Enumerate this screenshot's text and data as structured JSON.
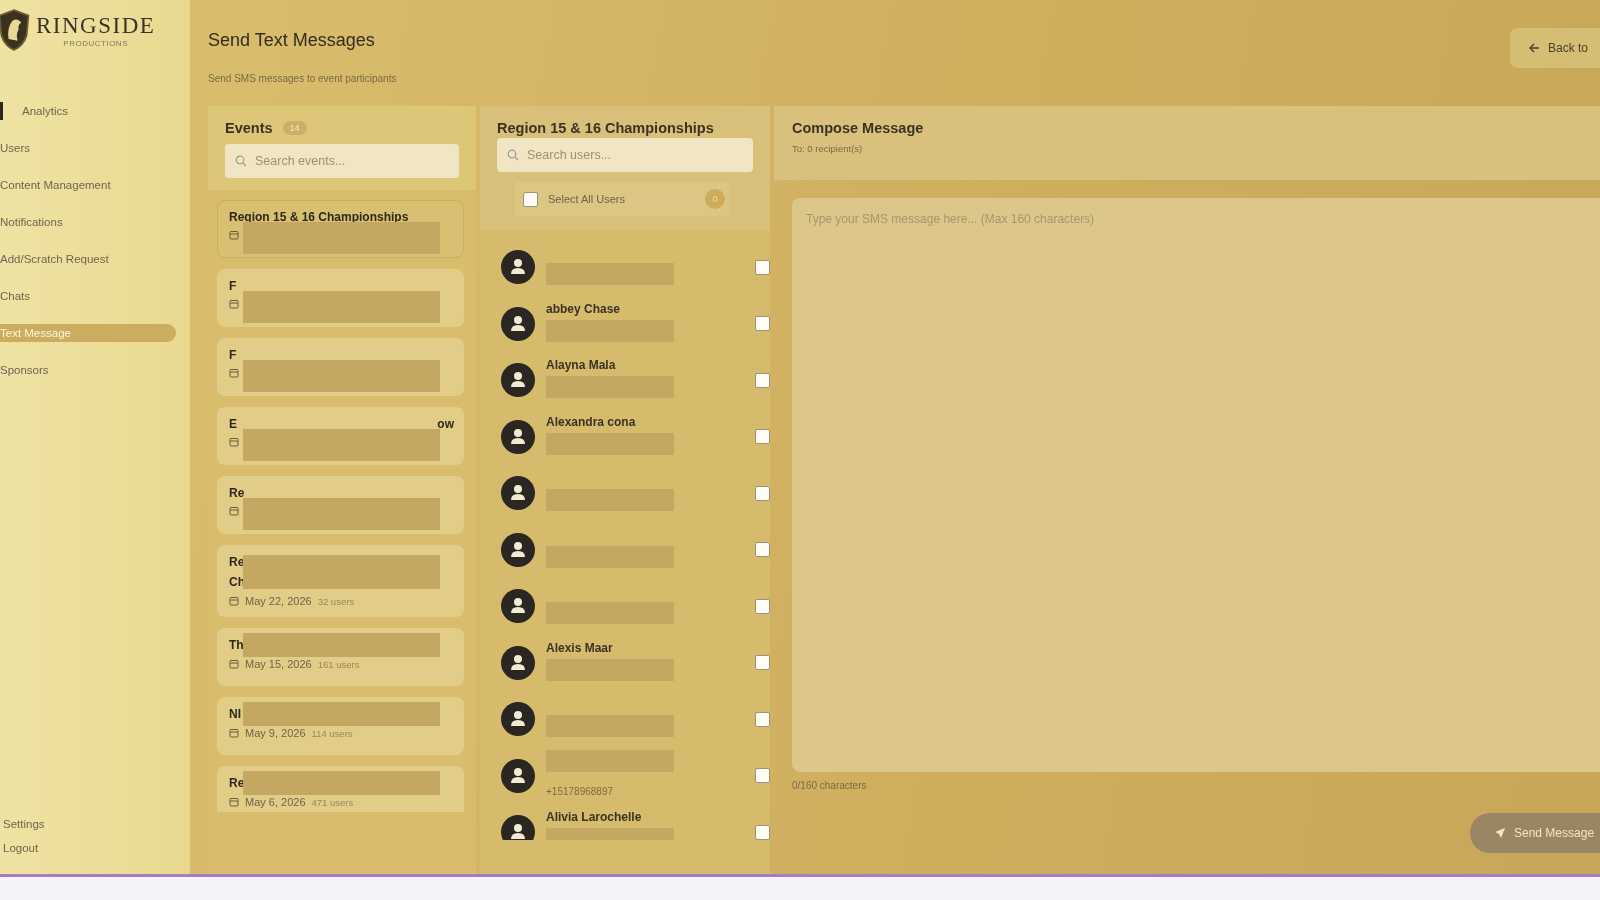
{
  "brand": {
    "name": "RINGSIDE",
    "tagline": "PRODUCTIONS"
  },
  "sidebar": {
    "items": [
      {
        "label": "Analytics",
        "selected": false
      },
      {
        "label": "Users",
        "selected": false
      },
      {
        "label": "Content Management",
        "selected": false
      },
      {
        "label": "Notifications",
        "selected": false
      },
      {
        "label": "Add/Scratch Request",
        "selected": false
      },
      {
        "label": "Chats",
        "selected": false
      },
      {
        "label": "Text Message",
        "selected": true
      },
      {
        "label": "Sponsors",
        "selected": false
      }
    ],
    "footer": [
      "Settings",
      "Logout"
    ]
  },
  "header": {
    "title": "Send Text Messages",
    "subtitle": "Send SMS messages to event participants",
    "back_button": "Back to"
  },
  "events": {
    "title": "Events",
    "count": "14",
    "search": {
      "placeholder": "Search events..."
    },
    "items": [
      {
        "title": "Region 15 & 16 Championships",
        "selected": true
      },
      {
        "title": "F",
        "selected": false
      },
      {
        "title": "F",
        "selected": false
      },
      {
        "title": "E",
        "title_end": "ow",
        "selected": false
      },
      {
        "title": "Re",
        "selected": false
      },
      {
        "title": "Re",
        "title_2": "Ch",
        "date": "May 22, 2026",
        "users": "32 users",
        "selected": false
      },
      {
        "title": "Th",
        "date": "May 15, 2026",
        "users": "161 users",
        "selected": false
      },
      {
        "title": "NI",
        "date": "May 9, 2026",
        "users": "114 users",
        "selected": false
      },
      {
        "title": "Re",
        "date": "May 6, 2026",
        "users": "471 users",
        "selected": false
      }
    ]
  },
  "users": {
    "title": "Region 15 & 16 Championships",
    "search": {
      "placeholder": "Search users..."
    },
    "select_all": {
      "label": "Select All Users",
      "checked": false,
      "count": "0"
    },
    "items": [
      {
        "checked": false
      },
      {
        "name": "abbey Chase",
        "checked": false
      },
      {
        "name": "Alayna Mala",
        "checked": false
      },
      {
        "name": "Alexandra cona",
        "checked": false
      },
      {
        "checked": false
      },
      {
        "checked": false
      },
      {
        "checked": false
      },
      {
        "name": "Alexis Maar",
        "checked": false
      },
      {
        "checked": false
      },
      {
        "phone": "+15178968897",
        "checked": false
      },
      {
        "name": "Alivia Larochelle",
        "checked": false
      }
    ]
  },
  "compose": {
    "title": "Compose Message",
    "recipients": "To: 0 recipient(s)",
    "placeholder": "Type your SMS message here... (Max 160 characters)",
    "counter": "0/160 characters",
    "send_button": "Send Message",
    "disabled": true
  }
}
